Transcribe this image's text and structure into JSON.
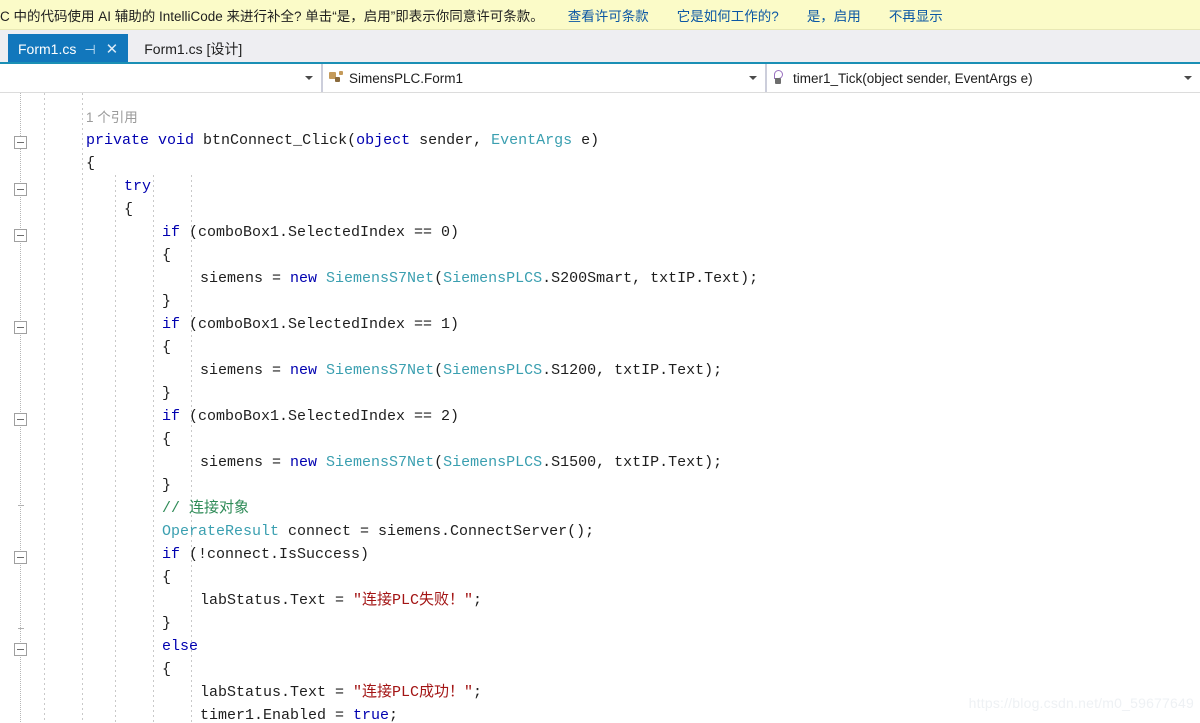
{
  "infobar": {
    "message": "C 中的代码使用 AI 辅助的 IntelliCode 来进行补全? 单击“是，启用”即表示你同意许可条款。",
    "links": [
      {
        "label": "查看许可条款"
      },
      {
        "label": "它是如何工作的?"
      },
      {
        "label": "是，启用"
      },
      {
        "label": "不再显示"
      }
    ]
  },
  "tabs": [
    {
      "label": "Form1.cs",
      "active": true,
      "pin": "⊣",
      "close": "✕"
    },
    {
      "label": "Form1.cs [设计]",
      "active": false
    }
  ],
  "navbar": {
    "project_selector": {
      "value": "",
      "icon": "chevron-down-icon"
    },
    "type_selector": {
      "value": "SimensPLC.Form1",
      "icon": "namespace-icon"
    },
    "member_selector": {
      "value": "timer1_Tick(object sender, EventArgs e)",
      "icon": "method-icon"
    }
  },
  "editor": {
    "codelens": "1 个引用",
    "lines": [
      {
        "indent": 0,
        "tokens": [
          {
            "c": "lens",
            "s": "1 个引用"
          }
        ]
      },
      {
        "indent": 0,
        "tokens": [
          {
            "c": "k",
            "s": "private"
          },
          {
            "c": "pl",
            "s": " "
          },
          {
            "c": "k",
            "s": "void"
          },
          {
            "c": "pl",
            "s": " btnConnect_Click("
          },
          {
            "c": "k",
            "s": "object"
          },
          {
            "c": "pl",
            "s": " sender, "
          },
          {
            "c": "t",
            "s": "EventArgs"
          },
          {
            "c": "pl",
            "s": " e)"
          }
        ]
      },
      {
        "indent": 0,
        "tokens": [
          {
            "c": "pl",
            "s": "{"
          }
        ]
      },
      {
        "indent": 1,
        "tokens": [
          {
            "c": "k",
            "s": "try"
          }
        ]
      },
      {
        "indent": 1,
        "tokens": [
          {
            "c": "pl",
            "s": "{"
          }
        ]
      },
      {
        "indent": 2,
        "tokens": [
          {
            "c": "k",
            "s": "if"
          },
          {
            "c": "pl",
            "s": " (comboBox1.SelectedIndex == 0)"
          }
        ]
      },
      {
        "indent": 2,
        "tokens": [
          {
            "c": "pl",
            "s": "{"
          }
        ]
      },
      {
        "indent": 3,
        "tokens": [
          {
            "c": "pl",
            "s": "siemens = "
          },
          {
            "c": "k",
            "s": "new"
          },
          {
            "c": "pl",
            "s": " "
          },
          {
            "c": "t",
            "s": "SiemensS7Net"
          },
          {
            "c": "pl",
            "s": "("
          },
          {
            "c": "t",
            "s": "SiemensPLCS"
          },
          {
            "c": "pl",
            "s": ".S200Smart, txtIP.Text);"
          }
        ]
      },
      {
        "indent": 2,
        "tokens": [
          {
            "c": "pl",
            "s": "}"
          }
        ]
      },
      {
        "indent": 2,
        "tokens": [
          {
            "c": "k",
            "s": "if"
          },
          {
            "c": "pl",
            "s": " (comboBox1.SelectedIndex == 1)"
          }
        ]
      },
      {
        "indent": 2,
        "tokens": [
          {
            "c": "pl",
            "s": "{"
          }
        ]
      },
      {
        "indent": 3,
        "tokens": [
          {
            "c": "pl",
            "s": "siemens = "
          },
          {
            "c": "k",
            "s": "new"
          },
          {
            "c": "pl",
            "s": " "
          },
          {
            "c": "t",
            "s": "SiemensS7Net"
          },
          {
            "c": "pl",
            "s": "("
          },
          {
            "c": "t",
            "s": "SiemensPLCS"
          },
          {
            "c": "pl",
            "s": ".S1200, txtIP.Text);"
          }
        ]
      },
      {
        "indent": 2,
        "tokens": [
          {
            "c": "pl",
            "s": "}"
          }
        ]
      },
      {
        "indent": 2,
        "tokens": [
          {
            "c": "k",
            "s": "if"
          },
          {
            "c": "pl",
            "s": " (comboBox1.SelectedIndex == 2)"
          }
        ]
      },
      {
        "indent": 2,
        "tokens": [
          {
            "c": "pl",
            "s": "{"
          }
        ]
      },
      {
        "indent": 3,
        "tokens": [
          {
            "c": "pl",
            "s": "siemens = "
          },
          {
            "c": "k",
            "s": "new"
          },
          {
            "c": "pl",
            "s": " "
          },
          {
            "c": "t",
            "s": "SiemensS7Net"
          },
          {
            "c": "pl",
            "s": "("
          },
          {
            "c": "t",
            "s": "SiemensPLCS"
          },
          {
            "c": "pl",
            "s": ".S1500, txtIP.Text);"
          }
        ]
      },
      {
        "indent": 2,
        "tokens": [
          {
            "c": "pl",
            "s": "}"
          }
        ]
      },
      {
        "indent": 2,
        "tokens": [
          {
            "c": "cm",
            "s": "// 连接对象"
          }
        ]
      },
      {
        "indent": 2,
        "tokens": [
          {
            "c": "t",
            "s": "OperateResult"
          },
          {
            "c": "pl",
            "s": " connect = siemens.ConnectServer();"
          }
        ]
      },
      {
        "indent": 2,
        "tokens": [
          {
            "c": "k",
            "s": "if"
          },
          {
            "c": "pl",
            "s": " (!connect.IsSuccess)"
          }
        ]
      },
      {
        "indent": 2,
        "tokens": [
          {
            "c": "pl",
            "s": "{"
          }
        ]
      },
      {
        "indent": 3,
        "tokens": [
          {
            "c": "pl",
            "s": "labStatus.Text = "
          },
          {
            "c": "str",
            "s": "\"连接PLC失败！\""
          },
          {
            "c": "pl",
            "s": ";"
          }
        ]
      },
      {
        "indent": 2,
        "tokens": [
          {
            "c": "pl",
            "s": "}"
          }
        ]
      },
      {
        "indent": 2,
        "tokens": [
          {
            "c": "k",
            "s": "else"
          }
        ]
      },
      {
        "indent": 2,
        "tokens": [
          {
            "c": "pl",
            "s": "{"
          }
        ]
      },
      {
        "indent": 3,
        "tokens": [
          {
            "c": "pl",
            "s": "labStatus.Text = "
          },
          {
            "c": "str",
            "s": "\"连接PLC成功！\""
          },
          {
            "c": "pl",
            "s": ";"
          }
        ]
      },
      {
        "indent": 3,
        "tokens": [
          {
            "c": "pl",
            "s": "timer1.Enabled = "
          },
          {
            "c": "k",
            "s": "true"
          },
          {
            "c": "pl",
            "s": ";"
          }
        ]
      }
    ],
    "outline_boxes": [
      136,
      183,
      229,
      321,
      413,
      551,
      643
    ],
    "outline_ticks": [
      505,
      628
    ]
  },
  "watermark": "https://blog.csdn.net/m0_59677649",
  "colors": {
    "infobar_bg": "#fbfbc8",
    "link": "#0b57a4",
    "tab_active_bg": "#1277bc",
    "tab_underline": "#1a8fb5",
    "keyword": "#0000b0",
    "type": "#3a9fb0",
    "comment": "#2e8b57",
    "string": "#a31515"
  }
}
